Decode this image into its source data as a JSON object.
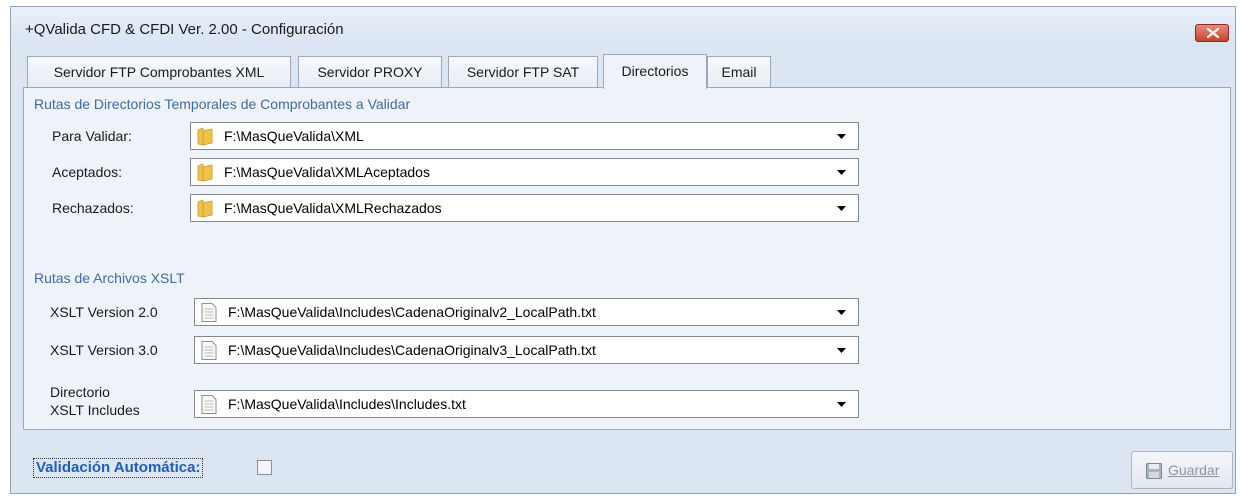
{
  "window": {
    "title": "+QValida CFD & CFDI Ver. 2.00 - Configuración"
  },
  "tabs": [
    {
      "label": "Servidor  FTP Comprobantes XML",
      "active": false
    },
    {
      "label": "Servidor PROXY",
      "active": false
    },
    {
      "label": "Servidor FTP SAT",
      "active": false
    },
    {
      "label": "Directorios",
      "active": true
    },
    {
      "label": "Email",
      "active": false
    }
  ],
  "directories": {
    "section_title": "Rutas de Directorios Temporales de Comprobantes a Validar",
    "rows": [
      {
        "label": "Para Validar:",
        "value": "F:\\MasQueValida\\XML",
        "icon": "folder-icon"
      },
      {
        "label": "Aceptados:",
        "value": "F:\\MasQueValida\\XMLAceptados",
        "icon": "folder-icon"
      },
      {
        "label": "Rechazados:",
        "value": "F:\\MasQueValida\\XMLRechazados",
        "icon": "folder-icon"
      }
    ]
  },
  "xslt": {
    "section_title": "Rutas de Archivos XSLT",
    "rows": [
      {
        "label": "XSLT Version 2.0",
        "value": "F:\\MasQueValida\\Includes\\CadenaOriginalv2_LocalPath.txt",
        "icon": "file-icon"
      },
      {
        "label": "XSLT Version 3.0",
        "value": "F:\\MasQueValida\\Includes\\CadenaOriginalv3_LocalPath.txt",
        "icon": "file-icon"
      },
      {
        "label_line1": "Directorio",
        "label_line2": "XSLT Includes",
        "value": "F:\\MasQueValida\\Includes\\Includes.txt",
        "icon": "file-icon"
      }
    ]
  },
  "footer": {
    "auto_validation_label": "Validación Automática:",
    "auto_validation_checked": false,
    "save_label": "Guardar",
    "save_enabled": false
  },
  "colors": {
    "section_title": "#3f6ba3",
    "footer_label": "#1f5fb4",
    "window_bg": "#dce6f3"
  }
}
